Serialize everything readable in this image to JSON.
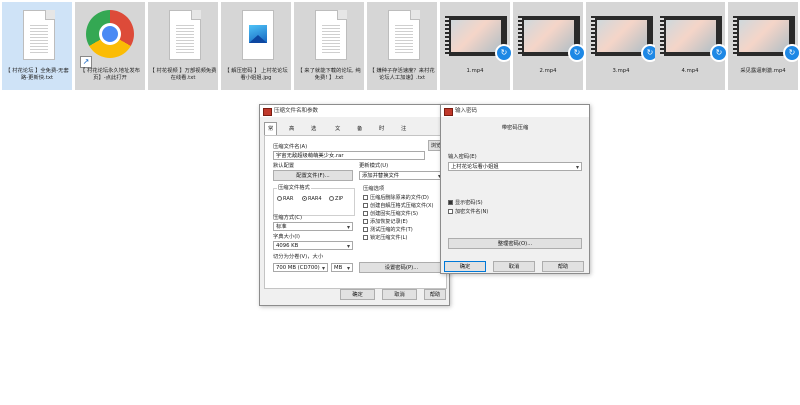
{
  "files": [
    {
      "name": "【 村花论坛 】全免费-无套路-更新快.txt",
      "type": "text",
      "selected": true
    },
    {
      "name": "【 村花论坛永久地址发布页】-点此打开",
      "type": "chrome-shortcut"
    },
    {
      "name": "【 村花视频 】万部视频免费在线看.txt",
      "type": "text"
    },
    {
      "name": "【 解压密码 】 上村花论坛看小姐姐.jpg",
      "type": "image"
    },
    {
      "name": "【 来了就能下载的论坛, 纯免费! 】.txt",
      "type": "text"
    },
    {
      "name": "【 嫌种子存活速度？来村花论坛人工加速】.txt",
      "type": "text"
    },
    {
      "name": "1.mp4",
      "type": "video"
    },
    {
      "name": "2.mp4",
      "type": "video"
    },
    {
      "name": "3.mp4",
      "type": "video"
    },
    {
      "name": "4.mp4",
      "type": "video"
    },
    {
      "name": "采见露逼刺激.mp4",
      "type": "video"
    }
  ],
  "archive_dialog": {
    "title": "压缩文件名和参数",
    "tabs": [
      "常规",
      "高级",
      "选项",
      "文件",
      "备份",
      "时间",
      "注释"
    ],
    "archive_name_label": "压缩文件名(A)",
    "archive_name_value": "宇宙无敌超级萌萌美少女.rar",
    "browse_label": "浏览",
    "default_profile_label": "默认配置",
    "profiles_button": "配置文件(F)...",
    "update_mode_label": "更新模式(U)",
    "update_mode_value": "添加并替换文件",
    "format_group": "压缩文件格式",
    "formats": [
      "RAR",
      "RAR4",
      "ZIP"
    ],
    "method_label": "压缩方式(C)",
    "method_value": "标准",
    "dict_label": "字典大小(I)",
    "dict_value": "4096 KB",
    "split_label": "切分为分卷(V)，大小",
    "split_value": "700 MB   (CD700)",
    "split_unit": "MB",
    "options_group": "压缩选项",
    "options": [
      {
        "label": "压缩后删除原来的文件(D)",
        "checked": false
      },
      {
        "label": "创建自解压格式压缩文件(X)",
        "checked": false
      },
      {
        "label": "创建固实压缩文件(S)",
        "checked": false
      },
      {
        "label": "添加恢复记录(E)",
        "checked": false
      },
      {
        "label": "测试压缩的文件(T)",
        "checked": false
      },
      {
        "label": "锁定压缩文件(L)",
        "checked": false
      }
    ],
    "set_password_button": "设置密码(P)...",
    "ok": "确定",
    "cancel": "取消",
    "help": "帮助"
  },
  "password_dialog": {
    "title": "输入密码",
    "heading": "带密码压缩",
    "input_label": "输入密码(E)",
    "input_value": "上村花论坛看小姐姐",
    "show_password_label": "显示密码(S)",
    "show_password_checked": true,
    "encrypt_names_label": "加密文件名(N)",
    "encrypt_names_checked": false,
    "organize_button": "整理密码(O)...",
    "ok": "确定",
    "cancel": "取消",
    "help": "帮助"
  }
}
